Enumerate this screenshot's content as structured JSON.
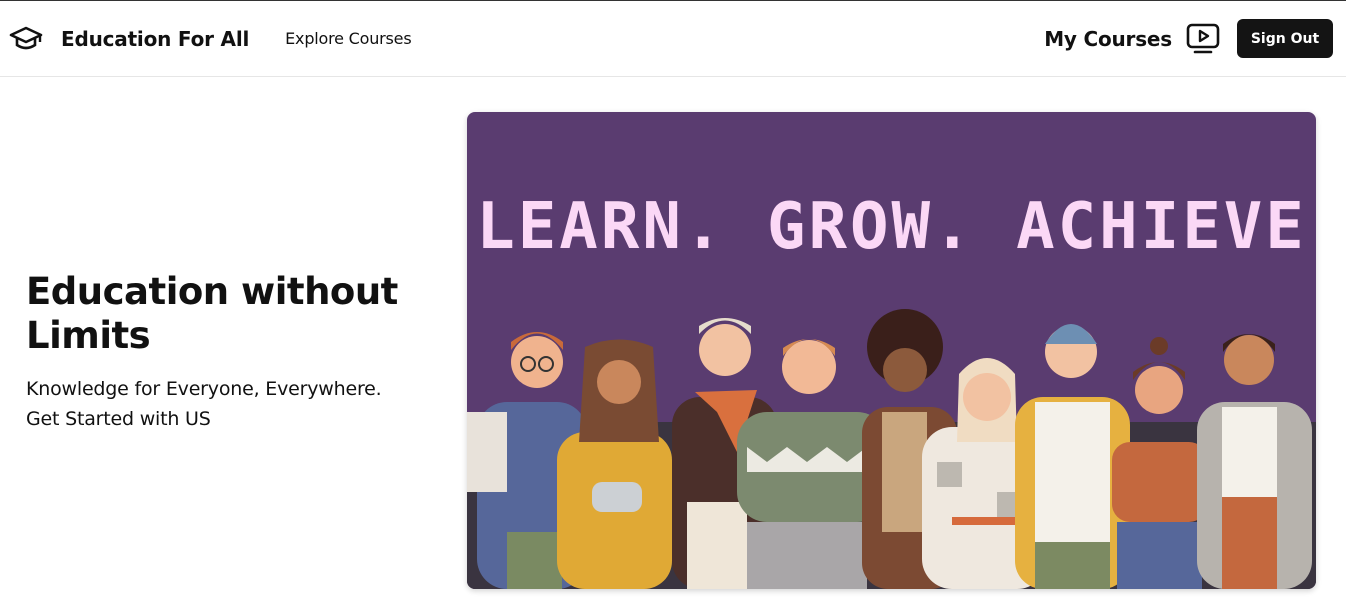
{
  "header": {
    "brand": "Education For All",
    "logo_icon": "graduation-cap-icon",
    "nav_link": "Explore Courses",
    "my_courses_label": "My Courses",
    "my_courses_icon": "video-player-icon",
    "sign_out_label": "Sign Out"
  },
  "hero": {
    "title": "Education without Limits",
    "subtitle_line1": "Knowledge for Everyone, Everywhere.",
    "subtitle_line2": "Get Started with US"
  },
  "banner": {
    "headline": "LEARN. GROW. ACHIEVE",
    "background": "#5a3c70",
    "headline_color": "#fbd8f6",
    "illustration": "diverse group of people illustration"
  }
}
